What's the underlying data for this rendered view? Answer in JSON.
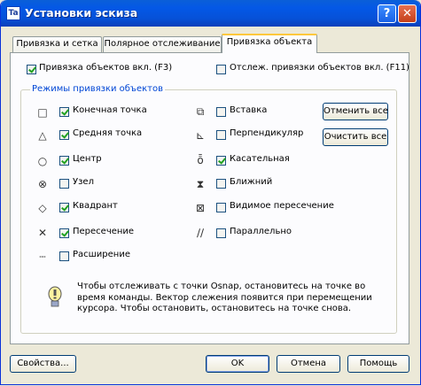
{
  "window": {
    "title": "Установки эскиза",
    "app_icon": "Ta"
  },
  "titlebar_buttons": {
    "help": "?",
    "close": "✕"
  },
  "tabs": [
    {
      "label": "Привязка и сетка",
      "active": false
    },
    {
      "label": "Полярное отслеживание",
      "active": false
    },
    {
      "label": "Привязка объекта",
      "active": true
    }
  ],
  "top_options": {
    "osnap_on": {
      "label": "Привязка объектов вкл. (F3)",
      "checked": true
    },
    "otrack_on": {
      "label": "Отслеж. привязки объектов вкл. (F11)",
      "checked": false
    }
  },
  "modes_group": {
    "title": "Режимы привязки объектов"
  },
  "modes_left": [
    {
      "icon": "square-endpoint-icon",
      "glyph": "□",
      "label": "Конечная точка",
      "checked": true
    },
    {
      "icon": "triangle-midpoint-icon",
      "glyph": "△",
      "label": "Средняя точка",
      "checked": true
    },
    {
      "icon": "circle-center-icon",
      "glyph": "○",
      "label": "Центр",
      "checked": true
    },
    {
      "icon": "node-icon",
      "glyph": "⊗",
      "label": "Узел",
      "checked": false
    },
    {
      "icon": "diamond-quadrant-icon",
      "glyph": "◇",
      "label": "Квадрант",
      "checked": true
    },
    {
      "icon": "x-intersection-icon",
      "glyph": "✕",
      "label": "Пересечение",
      "checked": true
    },
    {
      "icon": "extension-icon",
      "glyph": "┄",
      "label": "Расширение",
      "checked": false
    }
  ],
  "modes_right": [
    {
      "icon": "insertion-icon",
      "glyph": "⧉",
      "label": "Вставка",
      "checked": false
    },
    {
      "icon": "perpendicular-icon",
      "glyph": "⊾",
      "label": "Перпендикуляр",
      "checked": false
    },
    {
      "icon": "tangent-icon",
      "glyph": "ȭ",
      "label": "Касательная",
      "checked": true
    },
    {
      "icon": "nearest-icon",
      "glyph": "⧗",
      "label": "Ближний",
      "checked": false
    },
    {
      "icon": "apparent-intersection-icon",
      "glyph": "⊠",
      "label": "Видимое пересечение",
      "checked": false
    },
    {
      "icon": "parallel-icon",
      "glyph": "∕∕",
      "label": "Параллельно",
      "checked": false
    }
  ],
  "side_buttons": {
    "select_all": "Отменить все",
    "clear_all": "Очистить все"
  },
  "tip": {
    "icon": "lightbulb-icon",
    "text": "Чтобы отслеживать с точки Osnap, остановитесь на точке во время команды. Вектор слежения появится при перемещении курсора. Чтобы остановить, остановитесь на точке снова."
  },
  "footer": {
    "properties": "Свойства...",
    "ok": "OK",
    "cancel": "Отмена",
    "help": "Помощь"
  }
}
